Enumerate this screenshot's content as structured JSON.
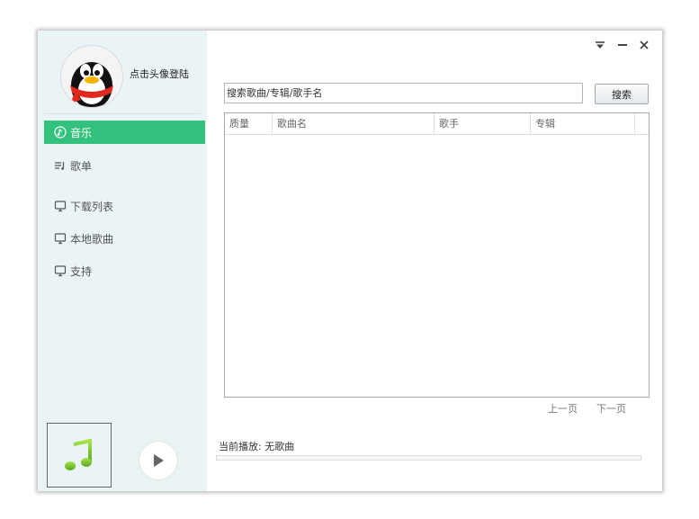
{
  "user": {
    "login_text": "点击头像登陆"
  },
  "nav": {
    "items": [
      {
        "label": "音乐",
        "icon": "music-note-circle-icon",
        "active": true
      },
      {
        "label": "歌单",
        "icon": "playlist-icon",
        "active": false
      },
      {
        "label": "下载列表",
        "icon": "monitor-icon",
        "active": false
      },
      {
        "label": "本地歌曲",
        "icon": "monitor-icon",
        "active": false
      },
      {
        "label": "支持",
        "icon": "monitor-icon",
        "active": false
      }
    ]
  },
  "window_controls": [
    "dropdown-menu-icon",
    "minimize-icon",
    "close-icon"
  ],
  "search": {
    "placeholder": "搜索歌曲/专辑/歌手名",
    "value": "",
    "button_label": "搜索"
  },
  "table": {
    "columns": [
      "质量",
      "歌曲名",
      "歌手",
      "专辑"
    ],
    "rows": []
  },
  "pager": {
    "prev_label": "上一页",
    "next_label": "下一页"
  },
  "player": {
    "now_playing_label": "当前播放:",
    "now_playing_value": "无歌曲",
    "progress": 0,
    "album_icon": "music-note-icon",
    "play_icon": "play-icon"
  },
  "colors": {
    "accent": "#33c27d",
    "sidebar_bg": "#eaf3f5"
  }
}
